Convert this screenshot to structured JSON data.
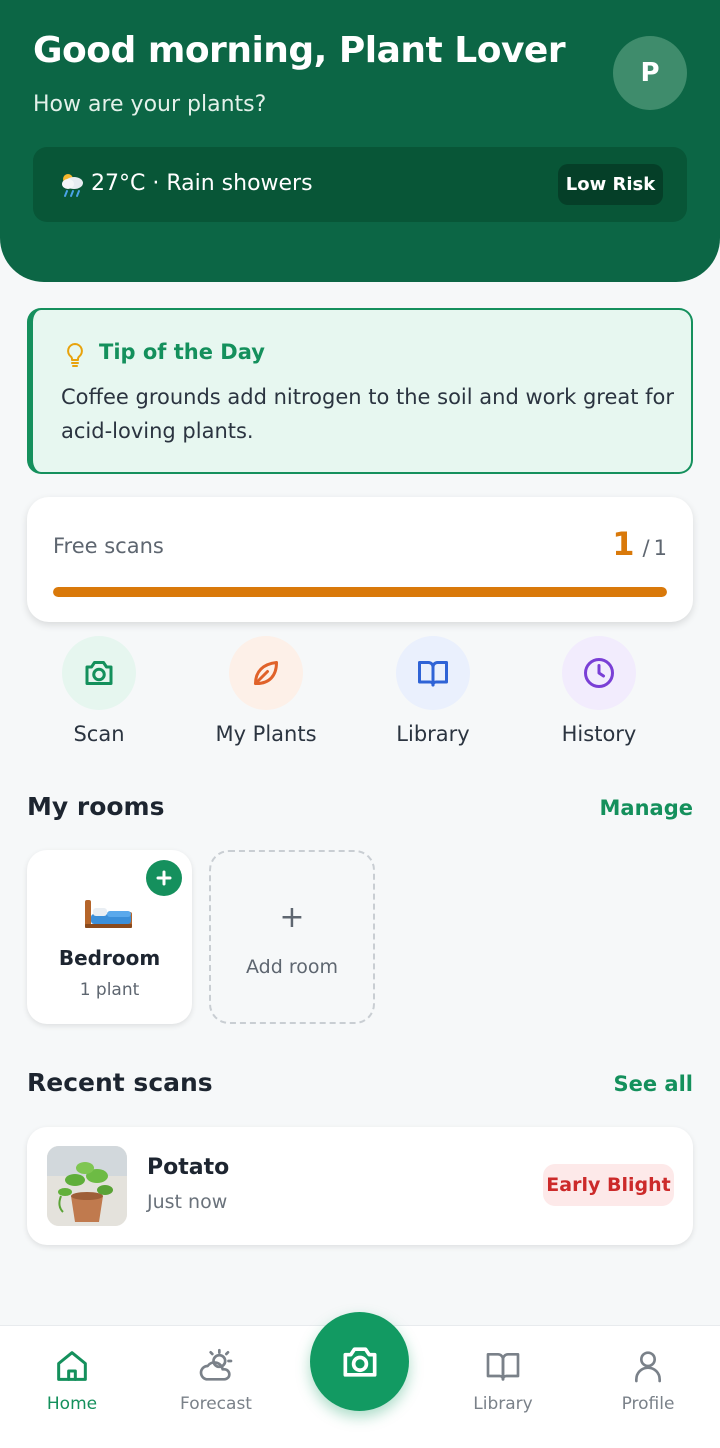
{
  "header": {
    "greeting": "Good morning, Plant Lover",
    "subtitle": "How are your plants?",
    "avatar_initial": "P",
    "weather": {
      "icon": "rain-cloud-icon",
      "text": "27°C · Rain showers",
      "risk": "Low Risk"
    }
  },
  "tip": {
    "icon": "lightbulb-icon",
    "title": "Tip of the Day",
    "body": "Coffee grounds add nitrogen to the soil and work great for acid-loving plants."
  },
  "free_scans": {
    "label": "Free scans",
    "used": "1",
    "separator": "/",
    "total": "1",
    "progress_fraction": 1.0
  },
  "quick_actions": [
    {
      "label": "Scan",
      "icon": "camera-icon",
      "color": "#14905c",
      "bg": "#e6f6ef"
    },
    {
      "label": "My Plants",
      "icon": "leaf-icon",
      "color": "#e0622a",
      "bg": "#fdf0e8"
    },
    {
      "label": "Library",
      "icon": "book-icon",
      "color": "#2f63d6",
      "bg": "#eaf0fd"
    },
    {
      "label": "History",
      "icon": "clock-icon",
      "color": "#7a3fd6",
      "bg": "#f2ecfd"
    }
  ],
  "rooms": {
    "title": "My rooms",
    "manage": "Manage",
    "items": [
      {
        "name": "Bedroom",
        "count": "1 plant",
        "icon": "bed-icon"
      }
    ],
    "add_plus": "+",
    "add_label": "Add room"
  },
  "recent": {
    "title": "Recent scans",
    "see_all": "See all",
    "items": [
      {
        "name": "Potato",
        "time": "Just now",
        "status": "Early Blight",
        "status_color": "#cc2a2a"
      }
    ]
  },
  "nav": {
    "items": [
      {
        "label": "Home",
        "icon": "home-icon",
        "active": true
      },
      {
        "label": "Forecast",
        "icon": "weather-icon",
        "active": false
      },
      {
        "label": "Library",
        "icon": "book-icon",
        "active": false
      },
      {
        "label": "Profile",
        "icon": "person-icon",
        "active": false
      }
    ],
    "fab_icon": "camera-icon"
  },
  "colors": {
    "brand": "#0c6645",
    "accent": "#14905c",
    "warning": "#d9790a",
    "danger": "#cc2a2a"
  }
}
